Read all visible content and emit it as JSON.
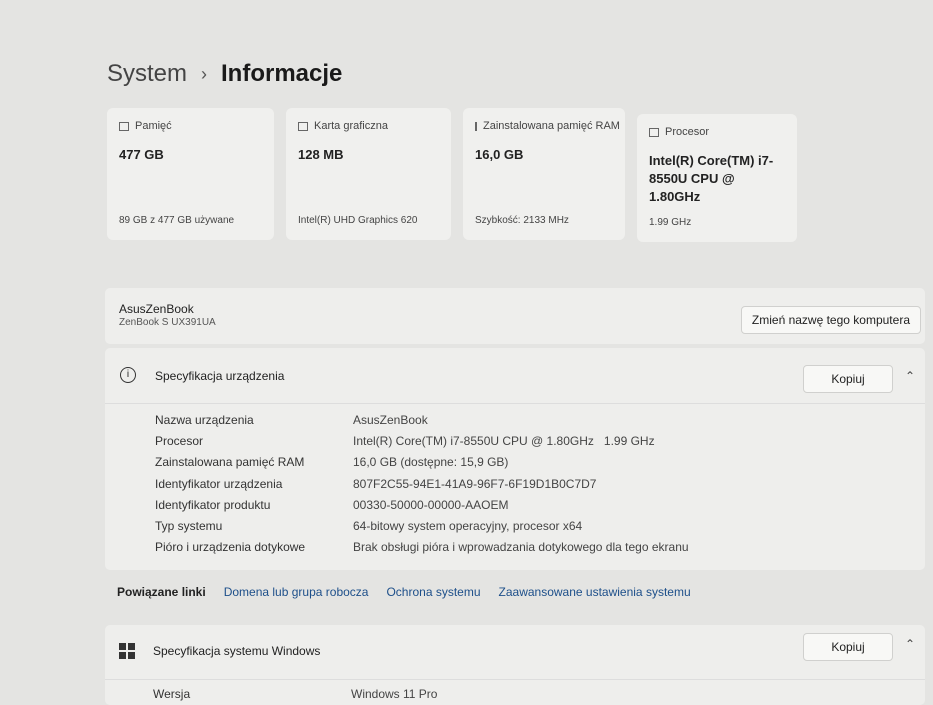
{
  "breadcrumb": {
    "parent": "System",
    "current": "Informacje"
  },
  "cards": [
    {
      "icon": "storage-icon",
      "label": "Pamięć",
      "value": "477 GB",
      "sub": "89 GB z 477 GB używane"
    },
    {
      "icon": "gpu-icon",
      "label": "Karta graficzna",
      "value": "128 MB",
      "sub": "Intel(R) UHD Graphics 620"
    },
    {
      "icon": "ram-icon",
      "label": "Zainstalowana pamięć RAM",
      "value": "16,0 GB",
      "sub": "Szybkość: 2133 MHz"
    },
    {
      "icon": "cpu-icon",
      "label": "Procesor",
      "value": "Intel(R) Core(TM) i7-8550U CPU @ 1.80GHz",
      "sub": "1.99 GHz"
    }
  ],
  "device": {
    "name": "AsusZenBook",
    "model": "ZenBook S UX391UA",
    "rename_label": "Zmień nazwę tego komputera"
  },
  "device_spec": {
    "title": "Specyfikacja urządzenia",
    "copy_label": "Kopiuj",
    "rows": [
      {
        "k": "Nazwa urządzenia",
        "v": "AsusZenBook"
      },
      {
        "k": "Procesor",
        "v": "Intel(R) Core(TM) i7-8550U CPU @ 1.80GHz   1.99 GHz"
      },
      {
        "k": "Zainstalowana pamięć RAM",
        "v": "16,0 GB (dostępne: 15,9 GB)"
      },
      {
        "k": "Identyfikator urządzenia",
        "v": "807F2C55-94E1-41A9-96F7-6F19D1B0C7D7"
      },
      {
        "k": "Identyfikator produktu",
        "v": "00330-50000-00000-AAOEM"
      },
      {
        "k": "Typ systemu",
        "v": "64-bitowy system operacyjny, procesor x64"
      },
      {
        "k": "Pióro i urządzenia dotykowe",
        "v": "Brak obsługi pióra i wprowadzania dotykowego dla tego ekranu"
      }
    ]
  },
  "related": {
    "label": "Powiązane linki",
    "links": [
      "Domena lub grupa robocza",
      "Ochrona systemu",
      "Zaawansowane ustawienia systemu"
    ]
  },
  "windows_spec": {
    "title": "Specyfikacja systemu Windows",
    "copy_label": "Kopiuj",
    "rows": [
      {
        "k": "Wersja",
        "v": "Windows 11 Pro"
      }
    ]
  }
}
